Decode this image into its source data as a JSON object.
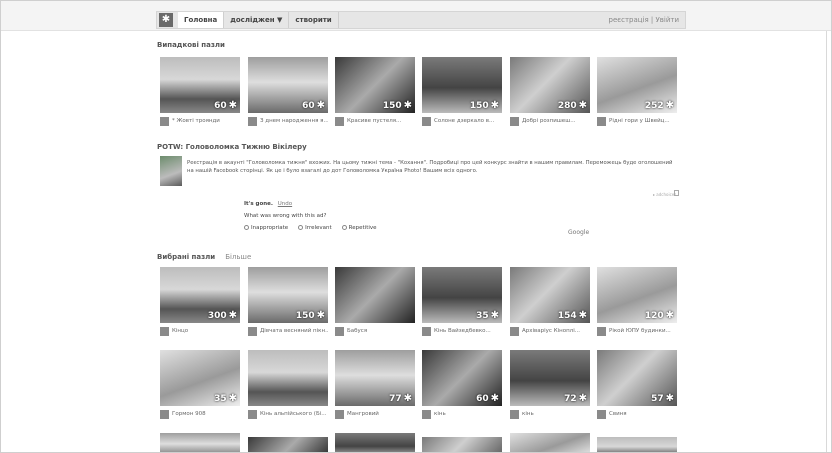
{
  "nav": {
    "logo_glyph": "✱",
    "tabs": [
      {
        "label": "Головна",
        "active": true
      },
      {
        "label": "досліджен ▼",
        "active": false
      },
      {
        "label": "створити",
        "active": false
      }
    ],
    "right_signin": "реєстрація",
    "right_sep": " | ",
    "right_login": "Увійти"
  },
  "sections": {
    "random_title": "Випадкові пазли",
    "potw_title": "POTW: Головоломка Тижню Вікілеру",
    "chosen_title": "Вибрані пазли",
    "chosen_more": "Більше"
  },
  "potw": {
    "text": "Реєстрація в акаунті \"Головоломка тижня\" вхожих. На цьому тижні тема - \"Кохання\". Подробиці про цей конкурс знайти в нашим правилам. Переможець буде оголошений на нашій Facebook сторінці. Як це і було взагалі до дот Головоломка Україна Photo! Вашим всіх одного."
  },
  "poll": {
    "label": "It's gone.",
    "undo": "Undo",
    "question": "What was wrong with this ad?",
    "options": [
      "Inappropriate",
      "Irrelevant",
      "Repetitive"
    ],
    "google": "Google"
  },
  "random_tiles": [
    {
      "count": "60",
      "caption": "* Жовті троянди"
    },
    {
      "count": "60",
      "caption": "З днем народження я..."
    },
    {
      "count": "150",
      "caption": "Красиве пустеля..."
    },
    {
      "count": "150",
      "caption": "Солоне дзеркало в..."
    },
    {
      "count": "280",
      "caption": "Добрі розпишеш..."
    },
    {
      "count": "252",
      "caption": "Рідні гори у Швейц..."
    }
  ],
  "chosen_row1": [
    {
      "count": "300",
      "caption": "Кінцо"
    },
    {
      "count": "150",
      "caption": "Дівчата весняний пікн..."
    },
    {
      "count": "",
      "caption": "Бабуся"
    },
    {
      "count": "35",
      "caption": "Кінь Вайзедбевко..."
    },
    {
      "count": "154",
      "caption": "Архіваріус Кіноплі..."
    },
    {
      "count": "120",
      "caption": "Рікой ЮПУ будинки..."
    }
  ],
  "chosen_row2": [
    {
      "count": "35",
      "caption": "Гормон 908"
    },
    {
      "count": "",
      "caption": "Кінь альпійського (Бі..."
    },
    {
      "count": "77",
      "caption": "Мангровий"
    },
    {
      "count": "60",
      "caption": "кінь"
    },
    {
      "count": "72",
      "caption": "кінь"
    },
    {
      "count": "57",
      "caption": "Свиня"
    }
  ],
  "colors": {
    "topbar": "#f4f4f4",
    "text": "#333333",
    "caption": "#666666"
  }
}
